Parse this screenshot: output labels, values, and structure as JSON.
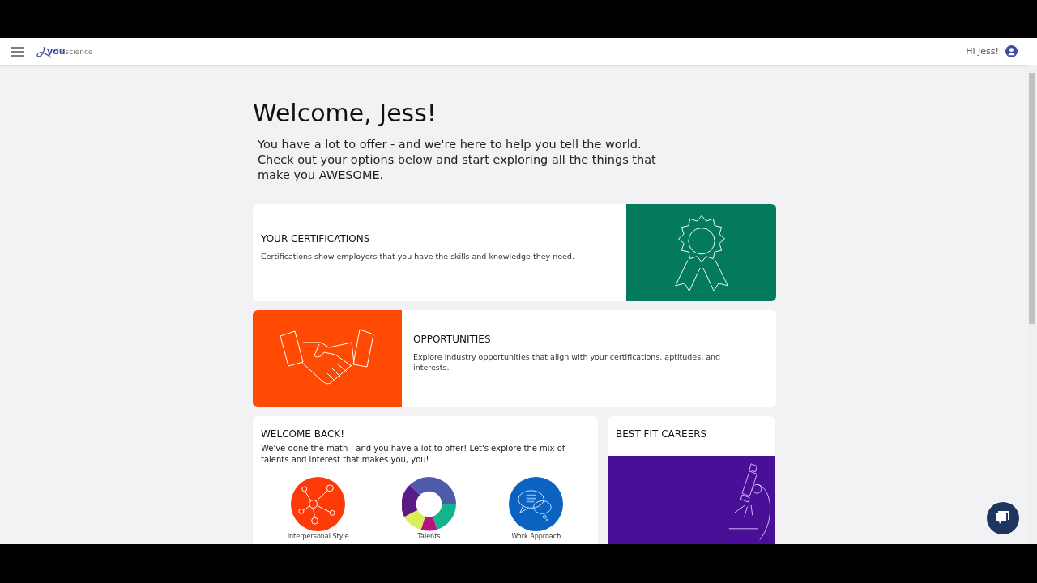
{
  "header": {
    "logo_bold": "you",
    "logo_rest": "science",
    "greeting": "Hi Jess!"
  },
  "welcome": {
    "title": "Welcome, Jess!",
    "intro": "You have a lot to offer - and we're here to help you tell the world. Check out your options below and start exploring all the things that make you AWESOME."
  },
  "feature_cards": [
    {
      "title": "YOUR CERTIFICATIONS",
      "description": "Certifications show employers that you have the skills and knowledge they need.",
      "image_left": false,
      "kind": "ribbon",
      "color": "#037a5c"
    },
    {
      "title": "OPPORTUNITIES",
      "description": "Explore industry opportunities that align with your certifications, aptitudes, and interests.",
      "image_left": true,
      "kind": "handshake",
      "color": "#fe4a03"
    }
  ],
  "welcome_back": {
    "title": "WELCOME BACK!",
    "text": "We've done the math - and you have a lot to offer! Let's explore the mix of talents and interest that makes you, you!",
    "items": [
      {
        "label": "Interpersonal Style",
        "kind": "network"
      },
      {
        "label": "Talents",
        "kind": "donut"
      },
      {
        "label": "Work Approach",
        "kind": "chat"
      }
    ]
  },
  "best_fit": {
    "title": "BEST FIT CAREERS"
  }
}
